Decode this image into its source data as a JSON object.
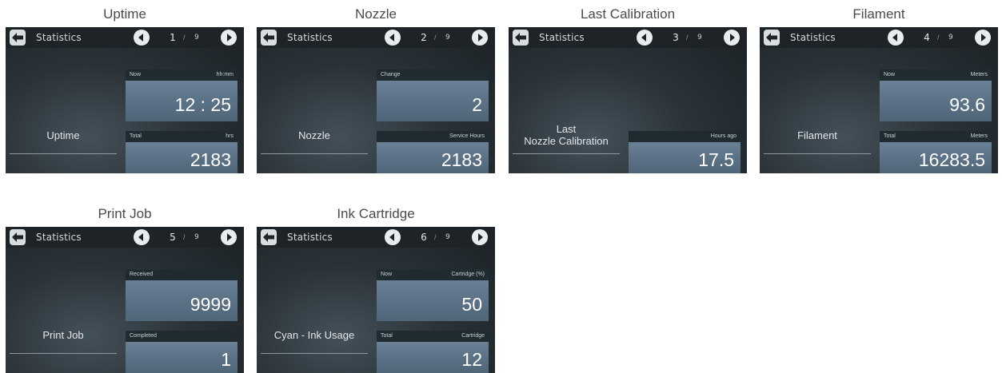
{
  "tiles": [
    {
      "caption": "Uptime",
      "bar_title": "Statistics",
      "page": "1",
      "page_total": "9",
      "label": "Uptime",
      "top": {
        "head_left": "Now",
        "head_right": "hh:mm",
        "value": "12 : 25"
      },
      "bottom": {
        "head_left": "Total",
        "head_right": "hrs",
        "value": "2183"
      }
    },
    {
      "caption": "Nozzle",
      "bar_title": "Statistics",
      "page": "2",
      "page_total": "9",
      "label": "Nozzle",
      "top": {
        "head_left": "Change",
        "head_right": "",
        "value": "2"
      },
      "bottom": {
        "head_left": "",
        "head_right": "Service Hours",
        "value": "2183"
      }
    },
    {
      "caption": "Last Calibration",
      "bar_title": "Statistics",
      "page": "3",
      "page_total": "9",
      "label": "Last\nNozzle Calibration",
      "top": null,
      "bottom": {
        "head_left": "",
        "head_right": "Hours ago",
        "value": "17.5"
      }
    },
    {
      "caption": "Filament",
      "bar_title": "Statistics",
      "page": "4",
      "page_total": "9",
      "label": "Filament",
      "top": {
        "head_left": "Now",
        "head_right": "Meters",
        "value": "93.6"
      },
      "bottom": {
        "head_left": "Total",
        "head_right": "Meters",
        "value": "16283.5"
      }
    },
    {
      "caption": "Print Job",
      "bar_title": "Statistics",
      "page": "5",
      "page_total": "9",
      "label": "Print Job",
      "top": {
        "head_left": "Received",
        "head_right": "",
        "value": "9999"
      },
      "bottom": {
        "head_left": "Completed",
        "head_right": "",
        "value": "1"
      }
    },
    {
      "caption": "Ink Cartridge",
      "bar_title": "Statistics",
      "page": "6",
      "page_total": "9",
      "label": "Cyan - Ink Usage",
      "top": {
        "head_left": "Now",
        "head_right": "Cartridge (%)",
        "value": "50"
      },
      "bottom": {
        "head_left": "Total",
        "head_right": "Cartridge",
        "value": "12"
      }
    }
  ],
  "icons": {
    "back": "back-arrow-icon",
    "prev": "chevron-left-icon",
    "next": "chevron-right-icon"
  },
  "colors": {
    "screen_bg": "#2b3338",
    "topbar": "#1d2327",
    "panel_head": "#1f2a31",
    "panel_body": "#5d7488",
    "caption_text": "#4a4a4a"
  }
}
